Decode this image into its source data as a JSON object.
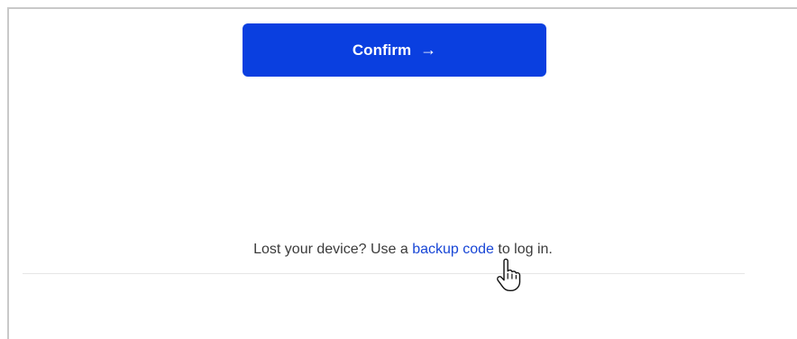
{
  "confirm": {
    "label": "Confirm",
    "arrow": "→",
    "color": "#0a3fe0"
  },
  "backup": {
    "prefix": "Lost your device? Use a ",
    "link_text": "backup code",
    "suffix": " to log in.",
    "link_color": "#1846d6"
  },
  "cursor": {
    "icon": "hand-pointer-icon"
  }
}
